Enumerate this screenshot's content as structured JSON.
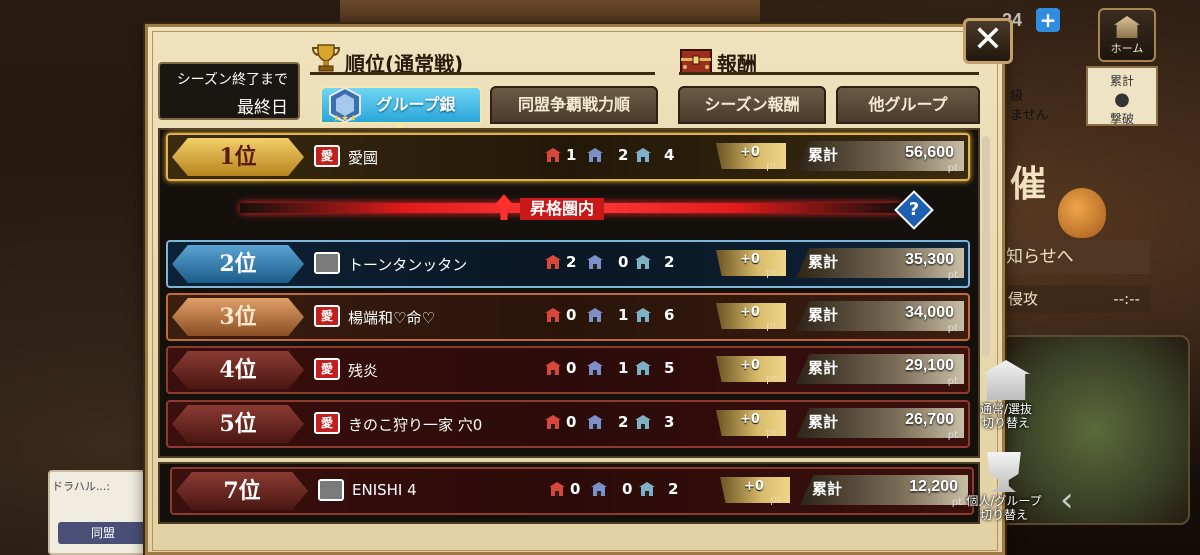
{
  "header": {
    "top_count": "24",
    "home_label": "ホーム"
  },
  "background": {
    "right_text1": "級",
    "right_text1b": "ません",
    "right_big": "催",
    "right_notice": "知らせへ",
    "right_attack": "侵攻",
    "right_attack_time": "--:--",
    "scroll_label": "累計",
    "scroll_sub": "撃破",
    "chat_text": "ドラハル...:",
    "chat_button": "同盟"
  },
  "panel": {
    "season_label": "シーズン終了まで",
    "season_value": "最終日",
    "heading_rank": "順位(通常戦)",
    "heading_reward": "報酬",
    "close_label": "✕"
  },
  "tabs": [
    {
      "label": "グループ銀",
      "active": true
    },
    {
      "label": "同盟争覇戦力順",
      "active": false
    },
    {
      "label": "シーズン報酬",
      "active": false
    },
    {
      "label": "他グループ",
      "active": false
    }
  ],
  "promo": {
    "label": "昇格圏内",
    "help": "?"
  },
  "rows": [
    {
      "rank": "1位",
      "clan_icon": "愛",
      "name": "愛國",
      "s1": "1",
      "s2": "2",
      "s3": "4",
      "pt": "+0",
      "pt_unit": "pt",
      "total_label": "累計",
      "total": "56,600",
      "total_unit": "pt"
    },
    {
      "rank": "2位",
      "clan_icon": "",
      "name": "トーンタンッタン",
      "s1": "2",
      "s2": "0",
      "s3": "2",
      "pt": "+0",
      "pt_unit": "pt",
      "total_label": "累計",
      "total": "35,300",
      "total_unit": "pt"
    },
    {
      "rank": "3位",
      "clan_icon": "愛",
      "name": "楊端和♡命♡",
      "s1": "0",
      "s2": "1",
      "s3": "6",
      "pt": "+0",
      "pt_unit": "pt",
      "total_label": "累計",
      "total": "34,000",
      "total_unit": "pt"
    },
    {
      "rank": "4位",
      "clan_icon": "愛",
      "name": "残炎",
      "s1": "0",
      "s2": "1",
      "s3": "5",
      "pt": "+0",
      "pt_unit": "pt",
      "total_label": "累計",
      "total": "29,100",
      "total_unit": "pt"
    },
    {
      "rank": "5位",
      "clan_icon": "愛",
      "name": "きのこ狩り一家 穴0",
      "s1": "0",
      "s2": "2",
      "s3": "3",
      "pt": "+0",
      "pt_unit": "pt",
      "total_label": "累計",
      "total": "26,700",
      "total_unit": "pt"
    }
  ],
  "my_row": {
    "rank": "7位",
    "clan_icon": "",
    "name": "ENISHI 4",
    "s1": "0",
    "s2": "0",
    "s3": "2",
    "pt": "+0",
    "pt_unit": "pt",
    "total_label": "累計",
    "total": "12,200",
    "total_unit": "pt"
  },
  "side_buttons": {
    "switch_mode": "通常/選抜\n切り替え",
    "switch_view": "個人/グループ\n切り替え"
  }
}
